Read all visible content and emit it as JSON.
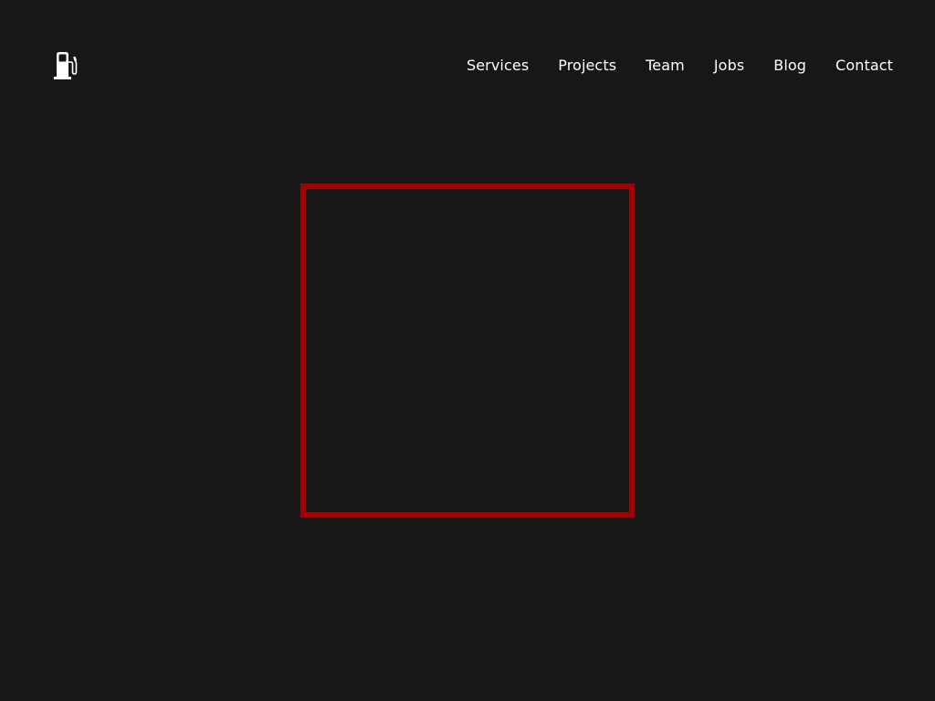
{
  "colors": {
    "background": "#171717",
    "text": "#ffffff",
    "frame_border": "#a30000"
  },
  "header": {
    "logo_icon": "fuel-pump-icon",
    "nav": [
      {
        "label": "Services"
      },
      {
        "label": "Projects"
      },
      {
        "label": "Team"
      },
      {
        "label": "Jobs"
      },
      {
        "label": "Blog"
      },
      {
        "label": "Contact"
      }
    ]
  }
}
